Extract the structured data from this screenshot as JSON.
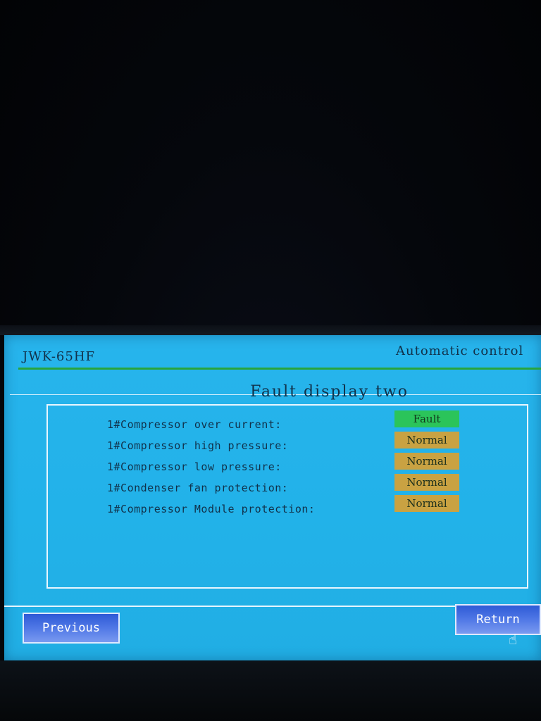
{
  "header": {
    "model": "JWK-65HF",
    "mode": "Automatic control"
  },
  "page": {
    "title": "Fault display two"
  },
  "faults": [
    {
      "label": "1#Compressor over current:",
      "status": "Fault",
      "state": "fault"
    },
    {
      "label": "1#Compressor high pressure:",
      "status": "Normal",
      "state": "normal"
    },
    {
      "label": "1#Compressor low pressure:",
      "status": "Normal",
      "state": "normal"
    },
    {
      "label": "1#Condenser fan protection:",
      "status": "Normal",
      "state": "normal"
    },
    {
      "label": "1#Compressor Module protection:",
      "status": "Normal",
      "state": "normal"
    }
  ],
  "footer": {
    "previous_label": "Previous",
    "return_label": "Return"
  },
  "colors": {
    "screen": "#22b2e9",
    "normal": "#c9a242",
    "fault": "#2bc45a",
    "button": "#3f68dd"
  },
  "icons": {
    "cursor": "hand-pointer-icon"
  }
}
